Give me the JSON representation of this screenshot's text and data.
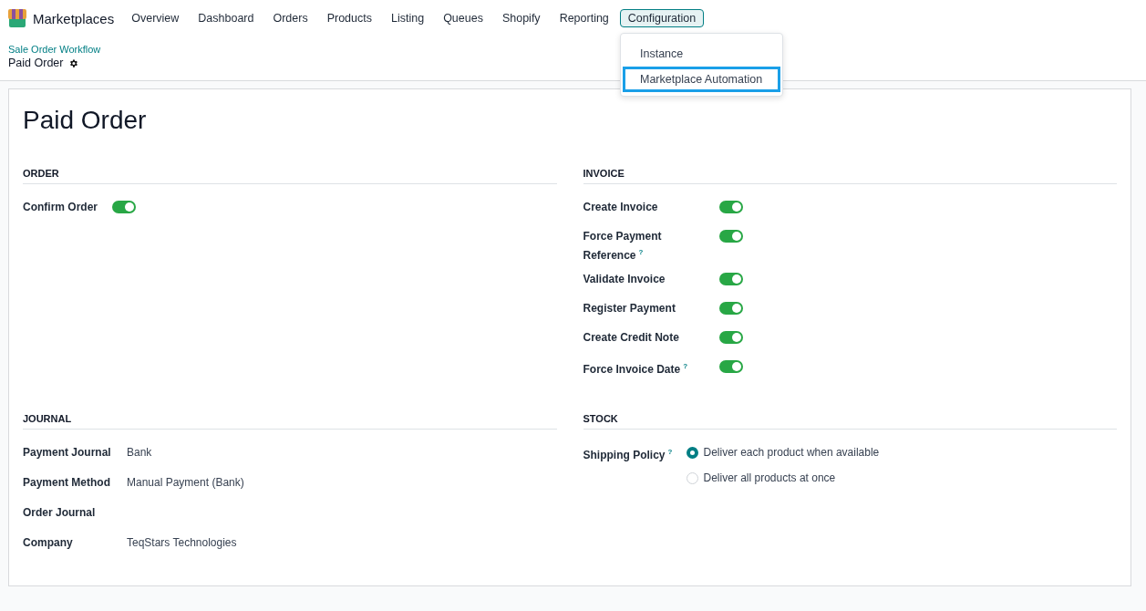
{
  "navbar": {
    "app_name": "Marketplaces",
    "menus": [
      {
        "label": "Overview",
        "selected": false
      },
      {
        "label": "Dashboard",
        "selected": false
      },
      {
        "label": "Orders",
        "selected": false
      },
      {
        "label": "Products",
        "selected": false
      },
      {
        "label": "Listing",
        "selected": false
      },
      {
        "label": "Queues",
        "selected": false
      },
      {
        "label": "Shopify",
        "selected": false
      },
      {
        "label": "Reporting",
        "selected": false
      },
      {
        "label": "Configuration",
        "selected": true
      }
    ],
    "dropdown": [
      {
        "label": "Instance",
        "selected": false
      },
      {
        "label": "Marketplace Automation",
        "selected": true
      }
    ]
  },
  "breadcrumb": {
    "parent": "Sale Order Workflow",
    "current": "Paid Order"
  },
  "form": {
    "title": "Paid Order",
    "order": {
      "heading": "ORDER",
      "fields": [
        {
          "label": "Confirm Order",
          "on": true
        }
      ]
    },
    "invoice": {
      "heading": "INVOICE",
      "fields": [
        {
          "label": "Create Invoice",
          "on": true
        },
        {
          "label": "Force Payment Reference",
          "help": "?",
          "on": true
        },
        {
          "label": "Validate Invoice",
          "on": true
        },
        {
          "label": "Register Payment",
          "on": true
        },
        {
          "label": "Create Credit Note",
          "on": true
        },
        {
          "label": "Force Invoice Date",
          "help": "?",
          "on": true
        }
      ]
    },
    "journal": {
      "heading": "JOURNAL",
      "fields": [
        {
          "label": "Payment Journal",
          "value": "Bank"
        },
        {
          "label": "Payment Method",
          "value": "Manual Payment (Bank)"
        },
        {
          "label": "Order Journal"
        },
        {
          "label": "Company",
          "value": "TeqStars Technologies"
        }
      ]
    },
    "stock": {
      "heading": "STOCK",
      "label": "Shipping Policy",
      "help": "?",
      "options": [
        {
          "label": "Deliver each product when available",
          "selected": true
        },
        {
          "label": "Deliver all products at once",
          "selected": false
        }
      ]
    }
  }
}
